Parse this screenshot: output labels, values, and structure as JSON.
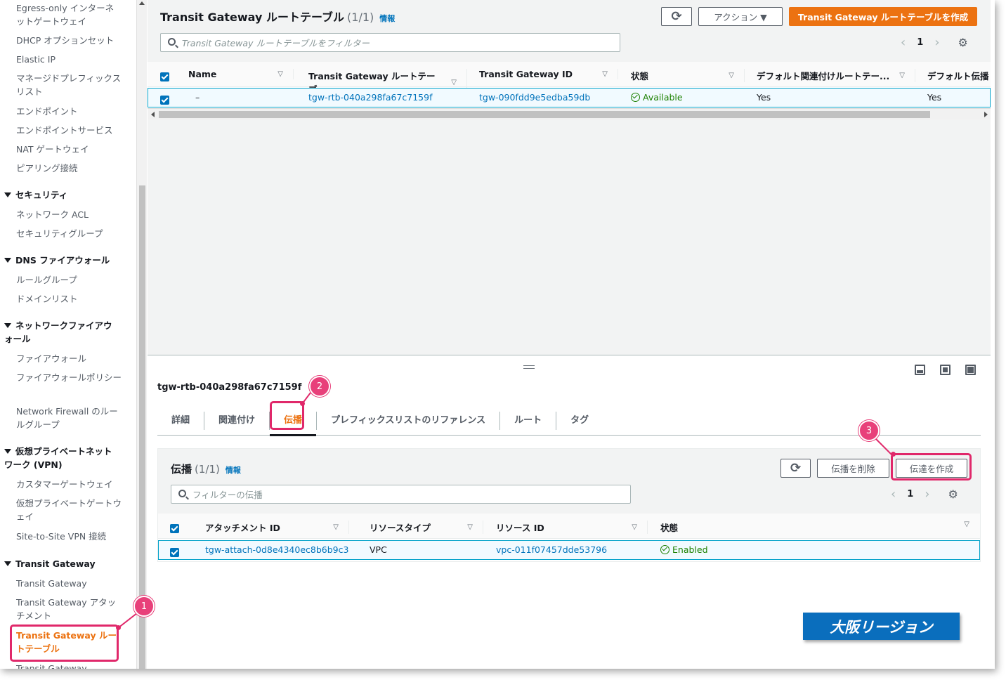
{
  "sidebar": {
    "items": [
      {
        "label": "Egress-only インターネットゲートウェイ"
      },
      {
        "label": "DHCP オプションセット"
      },
      {
        "label": "Elastic IP"
      },
      {
        "label": "マネージドプレフィックスリスト"
      },
      {
        "label": "エンドポイント"
      },
      {
        "label": "エンドポイントサービス"
      },
      {
        "label": "NAT ゲートウェイ"
      },
      {
        "label": "ピアリング接続"
      }
    ],
    "security_head": "セキュリティ",
    "security_items": [
      "ネットワーク ACL",
      "セキュリティグループ"
    ],
    "dns_head": "DNS ファイアウォール",
    "dns_items": [
      "ルールグループ",
      "ドメインリスト"
    ],
    "nfw_head": "ネットワークファイアウォール",
    "nfw_items": [
      "ファイアウォール",
      "ファイアウォールポリシー",
      "Network Firewall のルールグループ"
    ],
    "vpn_head": "仮想プライベートネットワーク (VPN)",
    "vpn_items": [
      "カスタマーゲートウェイ",
      "仮想プライベートゲートウェイ",
      "Site-to-Site VPN 接続"
    ],
    "tgw_head": "Transit Gateway",
    "tgw_items": [
      "Transit Gateway",
      "Transit Gateway アタッチメント",
      "Transit Gateway ルートテーブル",
      "Transit Gateway"
    ]
  },
  "top": {
    "title": "Transit Gateway ルートテーブル",
    "count": "(1/1)",
    "info": "情報",
    "actions_label": "アクション ▼",
    "create_label": "Transit Gateway ルートテーブルを作成",
    "search_placeholder": "Transit Gateway ルートテーブルをフィルター",
    "page": "1",
    "columns": [
      "Name",
      "Transit Gateway ルートテーブ...",
      "Transit Gateway ID",
      "状態",
      "デフォルト関連付けルートテー...",
      "デフォルト伝播"
    ],
    "row": {
      "name": "–",
      "rtb_id": "tgw-rtb-040a298fa67c7159f",
      "tgw_id": "tgw-090fdd9e5edba59db",
      "state": "Available",
      "default_assoc": "Yes",
      "default_prop": "Yes"
    }
  },
  "split": {
    "title": "tgw-rtb-040a298fa67c7159f",
    "tabs": [
      "詳細",
      "関連付け",
      "伝播",
      "プレフィックスリストのリファレンス",
      "ルート",
      "タグ"
    ],
    "inner_title": "伝播",
    "inner_count": "(1/1)",
    "info": "情報",
    "delete_label": "伝播を削除",
    "create_label": "伝達を作成",
    "search_placeholder": "フィルターの伝播",
    "page": "1",
    "columns": [
      "アタッチメント ID",
      "リソースタイプ",
      "リソース ID",
      "状態"
    ],
    "row": {
      "attach_id": "tgw-attach-0d8e4340ec8b6b9c3",
      "resource_type": "VPC",
      "resource_id": "vpc-011f07457dde53796",
      "state": "Enabled"
    }
  },
  "annotations": {
    "one": "1",
    "two": "2",
    "three": "3",
    "region": "大阪リージョン"
  },
  "colors": {
    "accent": "#ec7211",
    "link": "#0073bb",
    "highlight": "#e0286a",
    "region": "#0a6ebd"
  }
}
